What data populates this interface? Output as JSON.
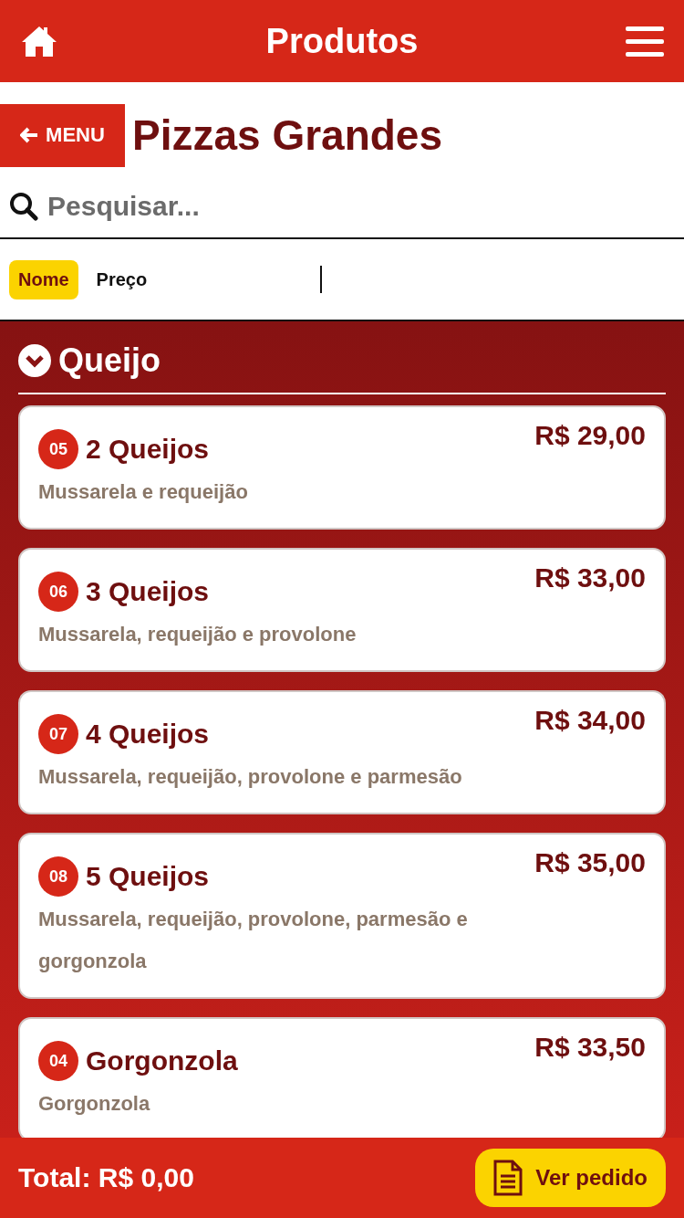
{
  "header": {
    "title": "Produtos"
  },
  "back_button": {
    "label": "MENU"
  },
  "page_title": "Pizzas Grandes",
  "search": {
    "placeholder": "Pesquisar..."
  },
  "sort_options": [
    {
      "label": "Nome",
      "selected": true
    },
    {
      "label": "Preço",
      "selected": false
    }
  ],
  "category": {
    "name": "Queijo",
    "expanded": true
  },
  "products": [
    {
      "code": "05",
      "name": "2 Queijos",
      "price": "R$ 29,00",
      "description": "Mussarela e requeijão"
    },
    {
      "code": "06",
      "name": "3 Queijos",
      "price": "R$ 33,00",
      "description": "Mussarela, requeijão e provolone"
    },
    {
      "code": "07",
      "name": "4 Queijos",
      "price": "R$ 34,00",
      "description": "Mussarela, requeijão, provolone e parmesão"
    },
    {
      "code": "08",
      "name": "5 Queijos",
      "price": "R$ 35,00",
      "description": "Mussarela, requeijão, provolone, parmesão e gorgonzola"
    },
    {
      "code": "04",
      "name": "Gorgonzola",
      "price": "R$ 33,50",
      "description": "Gorgonzola"
    }
  ],
  "footer": {
    "total": "Total: R$ 0,00",
    "order_button": "Ver pedido"
  }
}
